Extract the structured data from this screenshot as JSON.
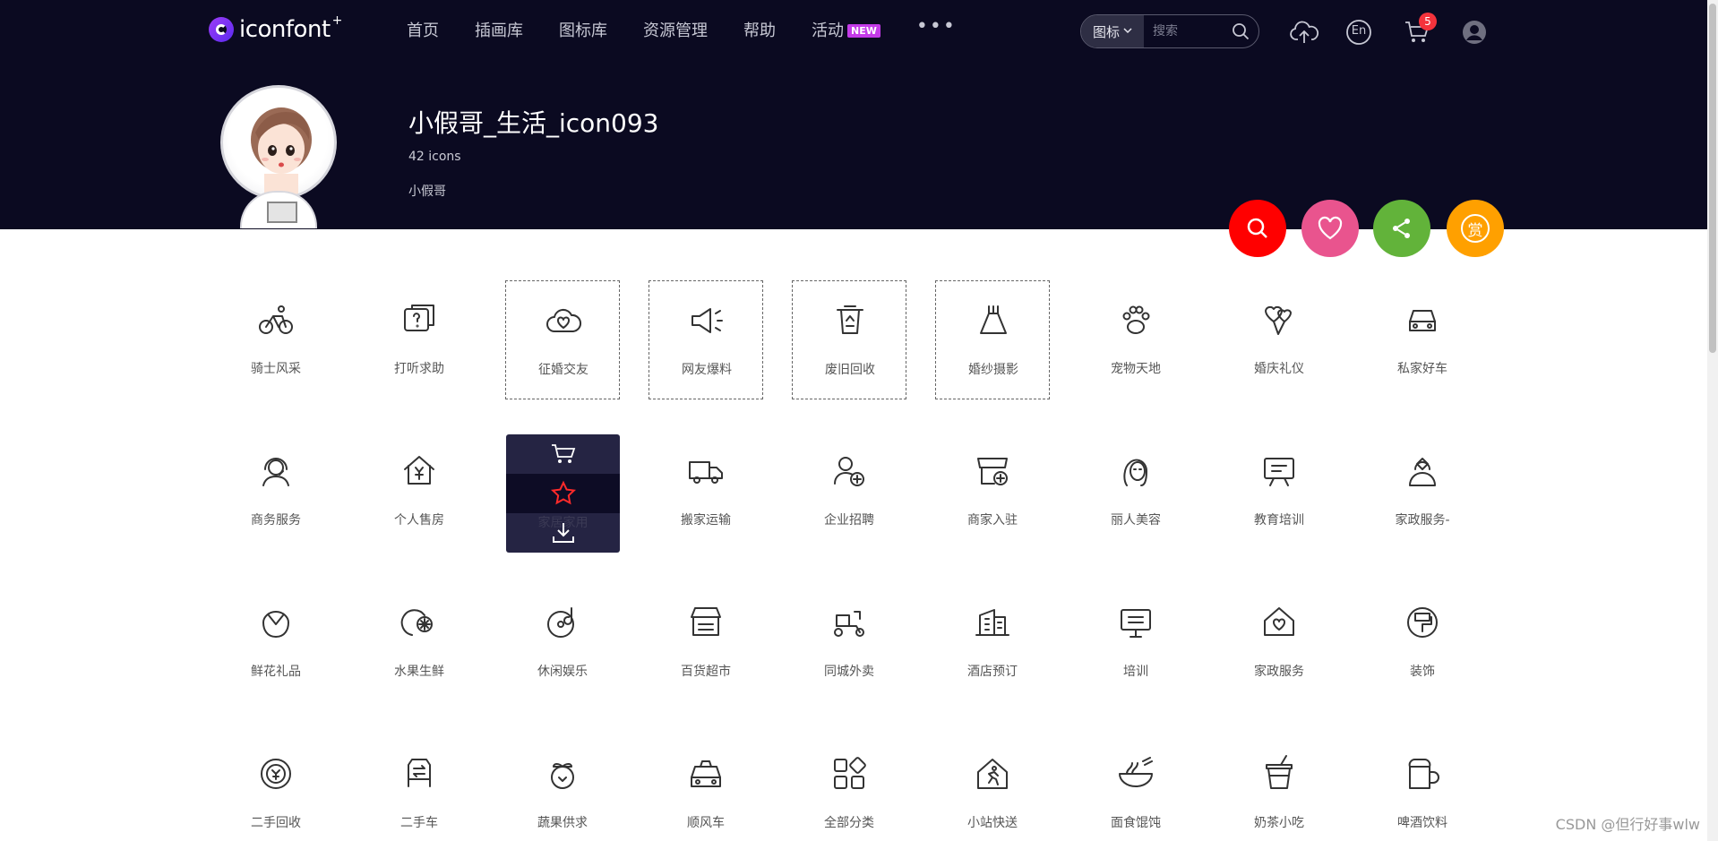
{
  "brand": {
    "name": "iconfont",
    "plus": "+"
  },
  "nav": {
    "items": [
      "首页",
      "插画库",
      "图标库",
      "资源管理",
      "帮助",
      "活动"
    ],
    "new_badge": "NEW",
    "more": "•••"
  },
  "search": {
    "type": "图标",
    "placeholder": "搜索"
  },
  "header_icons": {
    "lang": "En",
    "cart_count": "5"
  },
  "collection": {
    "title": "小假哥_生活_icon093",
    "count": "42 icons",
    "author": "小假哥"
  },
  "actions": [
    {
      "name": "search",
      "color": "#ff0000"
    },
    {
      "name": "like",
      "color": "#e9548e"
    },
    {
      "name": "share",
      "color": "#62b33a"
    },
    {
      "name": "reward",
      "color": "#ffa000",
      "label": "赏"
    }
  ],
  "icons": [
    {
      "label": "骑士风采",
      "icon": "bicycle-icon"
    },
    {
      "label": "打听求助",
      "icon": "question-chat-icon"
    },
    {
      "label": "征婚交友",
      "icon": "heart-cloud-icon",
      "dashed": true
    },
    {
      "label": "网友爆料",
      "icon": "megaphone-icon",
      "dashed": true
    },
    {
      "label": "废旧回收",
      "icon": "recycle-bin-icon",
      "dashed": true
    },
    {
      "label": "婚纱摄影",
      "icon": "wedding-dress-icon",
      "dashed": true
    },
    {
      "label": "宠物天地",
      "icon": "paw-icon"
    },
    {
      "label": "婚庆礼仪",
      "icon": "heart-balloon-icon"
    },
    {
      "label": "私家好车",
      "icon": "car-icon"
    },
    {
      "label": "商务服务",
      "icon": "headset-person-icon"
    },
    {
      "label": "个人售房",
      "icon": "house-yen-icon"
    },
    {
      "label": "家居家用",
      "icon": "home-goods-icon",
      "hovered": true
    },
    {
      "label": "搬家运输",
      "icon": "truck-icon"
    },
    {
      "label": "企业招聘",
      "icon": "user-add-icon"
    },
    {
      "label": "商家入驻",
      "icon": "store-add-icon"
    },
    {
      "label": "丽人美容",
      "icon": "face-mask-icon"
    },
    {
      "label": "教育培训",
      "icon": "easel-icon"
    },
    {
      "label": "家政服务-",
      "icon": "housekeeper-icon"
    },
    {
      "label": "鲜花礼品",
      "icon": "flower-icon"
    },
    {
      "label": "水果生鲜",
      "icon": "fruit-icon"
    },
    {
      "label": "休闲娱乐",
      "icon": "record-music-icon"
    },
    {
      "label": "百货超市",
      "icon": "shop-icon"
    },
    {
      "label": "同城外卖",
      "icon": "scooter-icon"
    },
    {
      "label": "酒店预订",
      "icon": "building-icon"
    },
    {
      "label": "培训",
      "icon": "board-icon"
    },
    {
      "label": "家政服务",
      "icon": "house-heart-icon"
    },
    {
      "label": "装饰",
      "icon": "paint-roller-icon"
    },
    {
      "label": "二手回收",
      "icon": "yen-cycle-icon"
    },
    {
      "label": "二手车",
      "icon": "car-swap-icon"
    },
    {
      "label": "蔬果供求",
      "icon": "vegetable-icon"
    },
    {
      "label": "顺风车",
      "icon": "taxi-icon"
    },
    {
      "label": "全部分类",
      "icon": "grid-icon"
    },
    {
      "label": "小站快送",
      "icon": "runner-house-icon"
    },
    {
      "label": "面食馄饨",
      "icon": "noodle-bowl-icon"
    },
    {
      "label": "奶茶小吃",
      "icon": "milk-tea-icon"
    },
    {
      "label": "啤酒饮料",
      "icon": "beer-mug-icon"
    }
  ],
  "hover_actions": [
    "add-to-cart",
    "favorite",
    "download"
  ],
  "watermark": "CSDN @但行好事wlw"
}
